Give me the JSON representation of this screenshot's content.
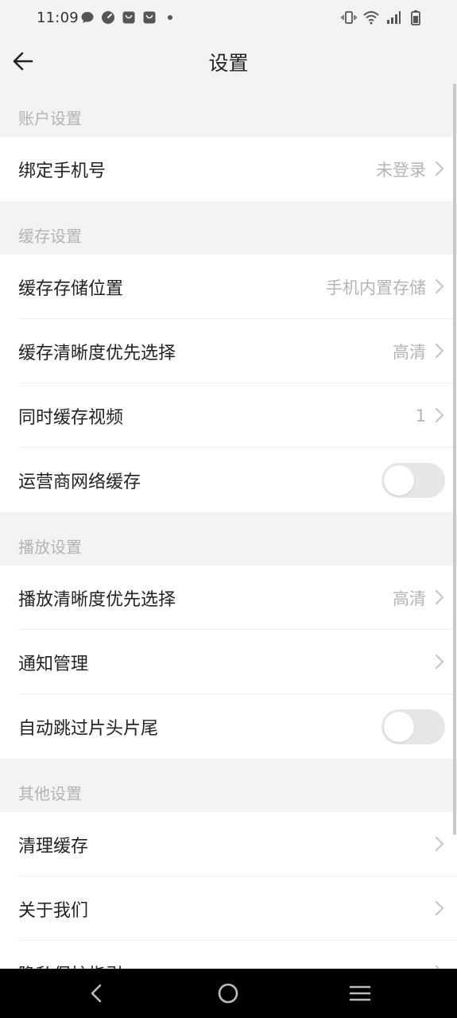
{
  "status_bar": {
    "time": "11:09",
    "left_icons": [
      "message-icon",
      "speedometer-icon",
      "shopping-bag-icon",
      "shopping-bag-icon",
      "dot-icon"
    ],
    "right_icons": [
      "vibrate-icon",
      "wifi-icon",
      "signal-icon",
      "battery-icon"
    ]
  },
  "header": {
    "title": "设置",
    "back_icon": "arrow-left-icon"
  },
  "sections": [
    {
      "title": "账户设置",
      "items": [
        {
          "label": "绑定手机号",
          "value": "未登录",
          "control": "chevron"
        }
      ]
    },
    {
      "title": "缓存设置",
      "items": [
        {
          "label": "缓存存储位置",
          "value": "手机内置存储",
          "control": "chevron"
        },
        {
          "label": "缓存清晰度优先选择",
          "value": "高清",
          "control": "chevron"
        },
        {
          "label": "同时缓存视频",
          "value": "1",
          "control": "chevron"
        },
        {
          "label": "运营商网络缓存",
          "value": "",
          "control": "toggle",
          "toggle_on": false
        }
      ]
    },
    {
      "title": "播放设置",
      "items": [
        {
          "label": "播放清晰度优先选择",
          "value": "高清",
          "control": "chevron"
        },
        {
          "label": "通知管理",
          "value": "",
          "control": "chevron"
        },
        {
          "label": "自动跳过片头片尾",
          "value": "",
          "control": "toggle",
          "toggle_on": false
        }
      ]
    },
    {
      "title": "其他设置",
      "items": [
        {
          "label": "清理缓存",
          "value": "",
          "control": "chevron"
        },
        {
          "label": "关于我们",
          "value": "",
          "control": "chevron"
        },
        {
          "label": "隐私保护指引",
          "value": "",
          "control": "chevron"
        }
      ]
    }
  ],
  "nav_bar": {
    "buttons": [
      "back-triangle-icon",
      "home-circle-icon",
      "menu-lines-icon"
    ]
  },
  "colors": {
    "background": "#f3f3f3",
    "row_background": "#ffffff",
    "section_title": "#b3b3b3",
    "value_text": "#b5b5b5",
    "toggle_off": "#e6e6e6",
    "nav_bar": "#000000"
  }
}
